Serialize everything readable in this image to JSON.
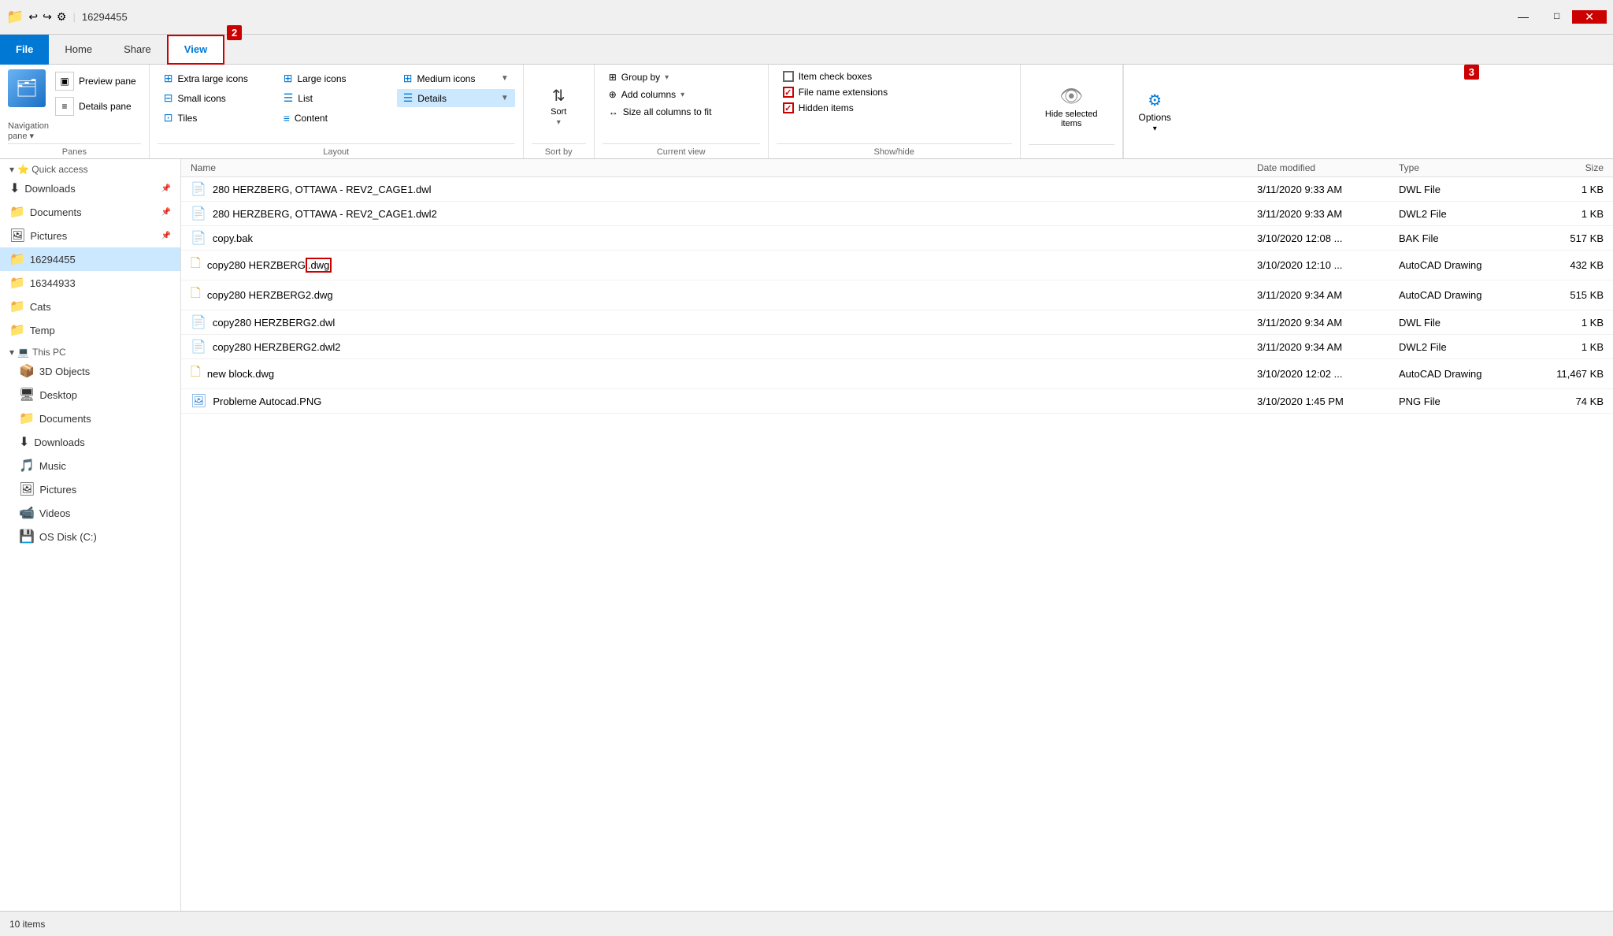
{
  "titleBar": {
    "icon": "📁",
    "title": "16294455",
    "quickAccess": [
      "undo",
      "redo",
      "properties"
    ],
    "separator": "|"
  },
  "ribbonTabs": [
    {
      "id": "file",
      "label": "File",
      "active": false,
      "fileTab": true
    },
    {
      "id": "home",
      "label": "Home",
      "active": false
    },
    {
      "id": "share",
      "label": "Share",
      "active": false
    },
    {
      "id": "view",
      "label": "View",
      "active": true
    }
  ],
  "ribbon": {
    "panes": {
      "label": "Panes",
      "navigationPane": "Navigation\npane",
      "previewPane": "Preview pane",
      "detailsPane": "Details pane"
    },
    "layout": {
      "label": "Layout",
      "items": [
        {
          "id": "extra-large",
          "label": "Extra large icons",
          "active": false
        },
        {
          "id": "large",
          "label": "Large icons",
          "active": false
        },
        {
          "id": "medium",
          "label": "Medium icons",
          "active": false
        },
        {
          "id": "small",
          "label": "Small icons",
          "active": false
        },
        {
          "id": "list",
          "label": "List",
          "active": false
        },
        {
          "id": "details",
          "label": "Details",
          "active": true
        },
        {
          "id": "tiles",
          "label": "Tiles",
          "active": false
        },
        {
          "id": "content",
          "label": "Content",
          "active": false
        }
      ]
    },
    "sort": {
      "label": "Sort\nby",
      "sortLabel": "Sort"
    },
    "currentView": {
      "label": "Current view",
      "groupBy": "Group by",
      "addColumns": "Add columns",
      "sizeAllColumns": "Size all columns to fit"
    },
    "showHide": {
      "label": "Show/hide",
      "itemCheckboxes": "Item check boxes",
      "fileNameExtensions": "File name extensions",
      "hiddenItems": "Hidden items",
      "hideSelectedItems": "Hide selected\nitems",
      "itemCheckboxesChecked": false,
      "fileNameExtensionsChecked": true,
      "hiddenItemsChecked": true
    },
    "options": {
      "label": "Options"
    }
  },
  "annotations": [
    {
      "id": "2",
      "label": "2"
    },
    {
      "id": "3",
      "label": "3"
    }
  ],
  "sidebar": {
    "quickAccess": [
      {
        "id": "downloads-quick",
        "label": "Downloads",
        "icon": "⬇",
        "pinned": true
      },
      {
        "id": "documents-quick",
        "label": "Documents",
        "icon": "📁",
        "pinned": true
      },
      {
        "id": "pictures-quick",
        "label": "Pictures",
        "icon": "🖼",
        "pinned": true
      },
      {
        "id": "folder-16294455",
        "label": "16294455",
        "icon": "📁",
        "active": true
      },
      {
        "id": "folder-16344933",
        "label": "16344933",
        "icon": "📁"
      },
      {
        "id": "folder-cats",
        "label": "Cats",
        "icon": "📁"
      },
      {
        "id": "folder-temp",
        "label": "Temp",
        "icon": "📁"
      }
    ],
    "thisPC": {
      "label": "This PC",
      "items": [
        {
          "id": "3d-objects",
          "label": "3D Objects",
          "icon": "📦"
        },
        {
          "id": "desktop",
          "label": "Desktop",
          "icon": "🖥"
        },
        {
          "id": "documents-pc",
          "label": "Documents",
          "icon": "📁"
        },
        {
          "id": "downloads-pc",
          "label": "Downloads",
          "icon": "⬇"
        },
        {
          "id": "music",
          "label": "Music",
          "icon": "🎵"
        },
        {
          "id": "pictures-pc",
          "label": "Pictures",
          "icon": "🖼"
        },
        {
          "id": "videos",
          "label": "Videos",
          "icon": "📹"
        },
        {
          "id": "osdisk",
          "label": "OS Disk (C:)",
          "icon": "💾"
        }
      ]
    }
  },
  "fileList": {
    "headers": [
      "Name",
      "Date modified",
      "Type",
      "Size"
    ],
    "files": [
      {
        "name": "280 HERZBERG, OTTAWA - REV2_CAGE1.dwl",
        "date": "3/11/2020 9:33 AM",
        "type": "DWL File",
        "size": "1 KB",
        "icon": "📄",
        "selected": false
      },
      {
        "name": "280 HERZBERG, OTTAWA - REV2_CAGE1.dwl2",
        "date": "3/11/2020 9:33 AM",
        "type": "DWL2 File",
        "size": "1 KB",
        "icon": "📄",
        "selected": false
      },
      {
        "name": "copy.bak",
        "date": "3/10/2020 12:08 ...",
        "type": "BAK File",
        "size": "517 KB",
        "icon": "📄",
        "selected": false
      },
      {
        "name": "copy280 HERZBERG",
        "ext": ".dwg",
        "date": "3/10/2020 12:10 ...",
        "type": "AutoCAD Drawing",
        "size": "432 KB",
        "icon": "🗋",
        "selected": false,
        "highlight": true
      },
      {
        "name": "copy280 HERZBERG2.dwg",
        "date": "3/11/2020 9:34 AM",
        "type": "AutoCAD Drawing",
        "size": "515 KB",
        "icon": "🗋",
        "selected": false
      },
      {
        "name": "copy280 HERZBERG2.dwl",
        "date": "3/11/2020 9:34 AM",
        "type": "DWL File",
        "size": "1 KB",
        "icon": "📄",
        "selected": false
      },
      {
        "name": "copy280 HERZBERG2.dwl2",
        "date": "3/11/2020 9:34 AM",
        "type": "DWL2 File",
        "size": "1 KB",
        "icon": "📄",
        "selected": false
      },
      {
        "name": "new block.dwg",
        "date": "3/10/2020 12:02 ...",
        "type": "AutoCAD Drawing",
        "size": "11,467 KB",
        "icon": "🗋",
        "selected": false
      },
      {
        "name": "Probleme Autocad.PNG",
        "date": "3/10/2020 1:45 PM",
        "type": "PNG File",
        "size": "74 KB",
        "icon": "🖼",
        "selected": false
      }
    ]
  },
  "statusBar": {
    "itemCount": "10 items"
  }
}
